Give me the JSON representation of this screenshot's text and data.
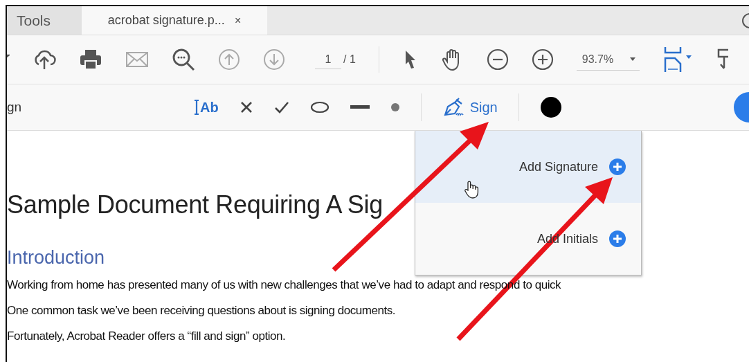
{
  "tabs": [
    {
      "label": "Tools",
      "selected": false
    },
    {
      "label": "acrobat signature.p...",
      "selected": true,
      "close": "×"
    }
  ],
  "toolbar": {
    "page_field": {
      "value": "1"
    },
    "page_total": "/ 1",
    "zoom": "93.7%"
  },
  "sign_toolbar": {
    "title": "gn",
    "text_tool": "Ab",
    "sign_button": "Sign"
  },
  "sign_menu": {
    "items": [
      {
        "label": "Add Signature",
        "selected": true
      },
      {
        "label": "Add Initials",
        "selected": false
      }
    ]
  },
  "document": {
    "heading": "Sample Document Requiring A Sig",
    "subheading": "Introduction",
    "paragraphs": [
      "Working from home has presented many of us with new challenges that we’ve had to adapt and respond to quick",
      "One common task we’ve been receiving questions about is signing documents.",
      "Fortunately, Acrobat Reader offers a “fill and sign” option."
    ]
  }
}
